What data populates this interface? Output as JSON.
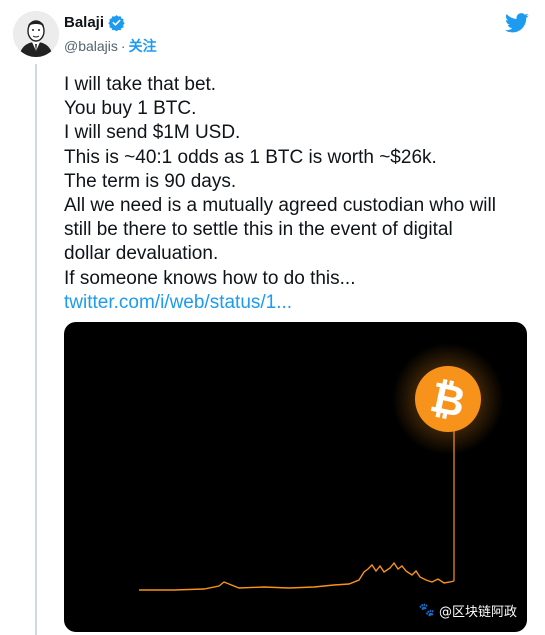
{
  "author": {
    "name": "Balaji",
    "handle": "@balajis",
    "separator": "·",
    "follow_label": "关注"
  },
  "tweet": {
    "lines": [
      "I will take that bet.",
      "You buy 1 BTC.",
      "I will send $1M USD.",
      "This is ~40:1 odds as 1 BTC is worth ~$26k.",
      "The term is 90 days.",
      "All we need is a mutually agreed custodian who will",
      "still be there to settle this in the event of digital",
      "dollar devaluation.",
      "If someone knows how to do this..."
    ],
    "link": "twitter.com/i/web/status/1..."
  },
  "media": {
    "coin_symbol": "₿",
    "watermark": "@区块链阿政",
    "colors": {
      "line": "#f7931a",
      "background": "#000000",
      "coin": "#f7931a"
    }
  },
  "icons": [
    "avatar",
    "verified-badge-icon",
    "twitter-bird-icon",
    "bitcoin-coin-icon",
    "paw-icon"
  ],
  "colors": {
    "link": "#1d9bf0",
    "text": "#0f1419",
    "secondary": "#536471"
  }
}
